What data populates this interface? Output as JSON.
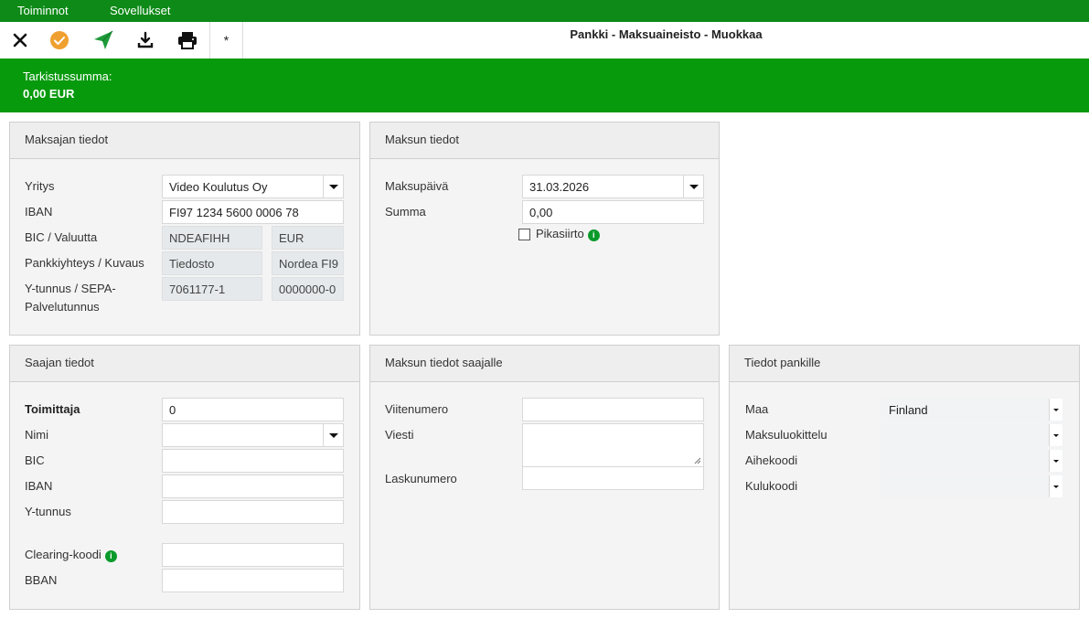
{
  "menubar": {
    "items": [
      "Toiminnot",
      "Sovellukset"
    ]
  },
  "toolbar": {
    "asterisk": "*"
  },
  "page_title": "Pankki - Maksuaineisto - Muokkaa",
  "banner": {
    "label": "Tarkistussumma:",
    "value": "0,00 EUR"
  },
  "payer": {
    "title": "Maksajan tiedot",
    "company_label": "Yritys",
    "company_value": "Video Koulutus Oy",
    "iban_label": "IBAN",
    "iban_value": "FI97 1234 5600 0006 78",
    "bic_label": "BIC / Valuutta",
    "bic_value": "NDEAFIHH",
    "currency_value": "EUR",
    "bankconn_label": "Pankkiyhteys / Kuvaus",
    "bankconn_value": "Tiedosto",
    "desc_value": "Nordea FI9",
    "ytunnus_label_1": "Y-tunnus / SEPA-",
    "ytunnus_label_2": "Palvelutunnus",
    "ytunnus_value": "7061177-1",
    "sepa_value": "0000000-0"
  },
  "payment": {
    "title": "Maksun tiedot",
    "date_label": "Maksupäivä",
    "date_value": "31.03.2026",
    "sum_label": "Summa",
    "sum_value": "0,00",
    "express_label": "Pikasiirto",
    "express_checked": false
  },
  "payee": {
    "title": "Saajan tiedot",
    "supplier_label": "Toimittaja",
    "supplier_value": "0",
    "name_label": "Nimi",
    "name_value": "",
    "bic_label": "BIC",
    "bic_value": "",
    "iban_label": "IBAN",
    "iban_value": "",
    "ytunnus_label": "Y-tunnus",
    "ytunnus_value": "",
    "clearing_label": "Clearing-koodi",
    "clearing_value": "",
    "bban_label": "BBAN",
    "bban_value": ""
  },
  "payment_for_payee": {
    "title": "Maksun tiedot saajalle",
    "ref_label": "Viitenumero",
    "ref_value": "",
    "message_label": "Viesti",
    "message_value": "",
    "invoice_label": "Laskunumero",
    "invoice_value": ""
  },
  "bank_info": {
    "title": "Tiedot pankille",
    "country_label": "Maa",
    "country_value": "Finland",
    "classification_label": "Maksuluokittelu",
    "classification_value": "",
    "subject_label": "Aihekoodi",
    "subject_value": "",
    "cost_label": "Kulukoodi",
    "cost_value": ""
  },
  "colors": {
    "brand_green": "#089a0d",
    "menubar_green": "#0d8a17",
    "approve_orange": "#f0a030",
    "info_green": "#0a9a2a"
  }
}
